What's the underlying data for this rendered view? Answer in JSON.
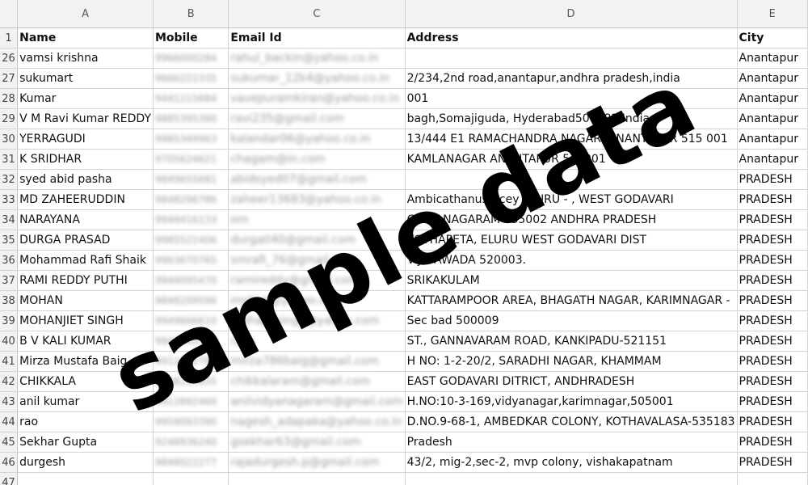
{
  "columns": [
    "",
    "A",
    "B",
    "C",
    "D",
    "E"
  ],
  "header_row": {
    "row": "1",
    "cells": [
      "Name",
      "Mobile",
      "Email Id",
      "Address",
      "City"
    ]
  },
  "rows": [
    {
      "row": "26",
      "name": "vamsi krishna",
      "mobile": "9966000284",
      "email": "rahul_backin@yahoo.co.in",
      "address": "",
      "city": "Anantapur"
    },
    {
      "row": "27",
      "name": "sukumart",
      "mobile": "9666222335",
      "email": "sukumar_12k4@yahoo.co.in",
      "address": "2/234,2nd road,anantapur,andhra pradesh,india",
      "city": "Anantapur"
    },
    {
      "row": "28",
      "name": "Kumar",
      "mobile": "9441215684",
      "email": "vavepuramkiran@yahoo.co.in",
      "address": "001",
      "city": "Anantapur"
    },
    {
      "row": "29",
      "name": "V M Ravi Kumar REDDY",
      "mobile": "9885395390",
      "email": "ravi235@gmail.com",
      "address": "bagh,Somajiguda, Hyderabad500082 India",
      "city": "Anantapur"
    },
    {
      "row": "30",
      "name": "YERRAGUDI",
      "mobile": "9985349963",
      "email": "kalandar06@yahoo.co.in",
      "address": "13/444 E1 RAMACHANDRA NAGAR, ANANTAPUR 515 001",
      "city": "Anantapur"
    },
    {
      "row": "31",
      "name": "K SRIDHAR",
      "mobile": "9705624621",
      "email": "chagam@in.com",
      "address": "KAMLANAGAR ANANTAPUR 515001",
      "city": "Anantapur"
    },
    {
      "row": "32",
      "name": "syed abid pasha",
      "mobile": "9849655681",
      "email": "abidsyed07@gmail.com",
      "address": "",
      "city": "PRADESH"
    },
    {
      "row": "33",
      "name": "MD ZAHEERUDDIN",
      "mobile": "9848296786",
      "email": "zaheer13683@yahoo.co.in",
      "address": "Ambicathanusrecey ELURU - , WEST GODAVARI",
      "city": "PRADESH"
    },
    {
      "row": "34",
      "name": "NARAYANA",
      "mobile": "9949416133",
      "email": "om",
      "address": "CHINANAGARAM 535002 ANDHRA PRADESH",
      "city": "PRADESH"
    },
    {
      "row": "35",
      "name": "DURGA PRASAD",
      "mobile": "9985522406",
      "email": "durga040@gmail.com",
      "address": "KOTHAPETA, ELURU WEST GODAVARI DIST",
      "city": "PRADESH"
    },
    {
      "row": "36",
      "name": "Mohammad Rafi Shaik",
      "mobile": "9963670765",
      "email": "smrafi_76@gmail.com",
      "address": "VIJAYAWADA 520003.",
      "city": "PRADESH"
    },
    {
      "row": "37",
      "name": "RAMI REDDY PUTHI",
      "mobile": "9949095470",
      "email": "ramireddy@gmail.com",
      "address": "SRIKAKULAM",
      "city": "PRADESH"
    },
    {
      "row": "38",
      "name": "MOHAN",
      "mobile": "9848209596",
      "email": "mohan@yahoo.com",
      "address": "KATTARAMPOOR AREA, BHAGATH NAGAR, KARIMNAGAR -",
      "city": "PRADESH"
    },
    {
      "row": "39",
      "name": "MOHANJIET SINGH",
      "mobile": "9949666610",
      "email": "mohan_singh@yahoo.com",
      "address": "Sec bad 500009",
      "city": "PRADESH"
    },
    {
      "row": "40",
      "name": "B V KALI KUMAR",
      "mobile": "9949640512",
      "email": "com",
      "address": "ST., GANNAVARAM ROAD, KANKIPADU-521151",
      "city": "PRADESH"
    },
    {
      "row": "41",
      "name": "Mirza Mustafa Baig",
      "mobile": "9912452786",
      "email": "mirza786baig@gmail.com",
      "address": "H NO: 1-2-20/2, SARADHI NAGAR, KHAMMAM",
      "city": "PRADESH"
    },
    {
      "row": "42",
      "name": "CHIKKALA",
      "mobile": "9848229955",
      "email": "chikkalaram@gmail.com",
      "address": "EAST GODAVARI DITRICT, ANDHRADESH",
      "city": "PRADESH"
    },
    {
      "row": "43",
      "name": "anil kumar",
      "mobile": "9912892460",
      "email": "anilvidyanagaram@gmail.com",
      "address": "H.NO:10-3-169,vidyanagar,karimnagar,505001",
      "city": "PRADESH"
    },
    {
      "row": "44",
      "name": "rao",
      "mobile": "9959093390",
      "email": "nagesh_adapaka@yahoo.co.in",
      "address": "D.NO.9-68-1, AMBEDKAR COLONY, KOTHAVALASA-535183",
      "city": "PRADESH"
    },
    {
      "row": "45",
      "name": "Sekhar Gupta",
      "mobile": "9248936240",
      "email": "gsekhar63@gmail.com",
      "address": "Pradesh",
      "city": "PRADESH"
    },
    {
      "row": "46",
      "name": "durgesh",
      "mobile": "9848022277",
      "email": "rajadurgesh.p@gmail.com",
      "address": "43/2, mig-2,sec-2, mvp colony, vishakapatnam",
      "city": "PRADESH"
    },
    {
      "row": "47",
      "name": "",
      "mobile": "",
      "email": "",
      "address": "",
      "city": ""
    }
  ],
  "watermark": "sample data"
}
